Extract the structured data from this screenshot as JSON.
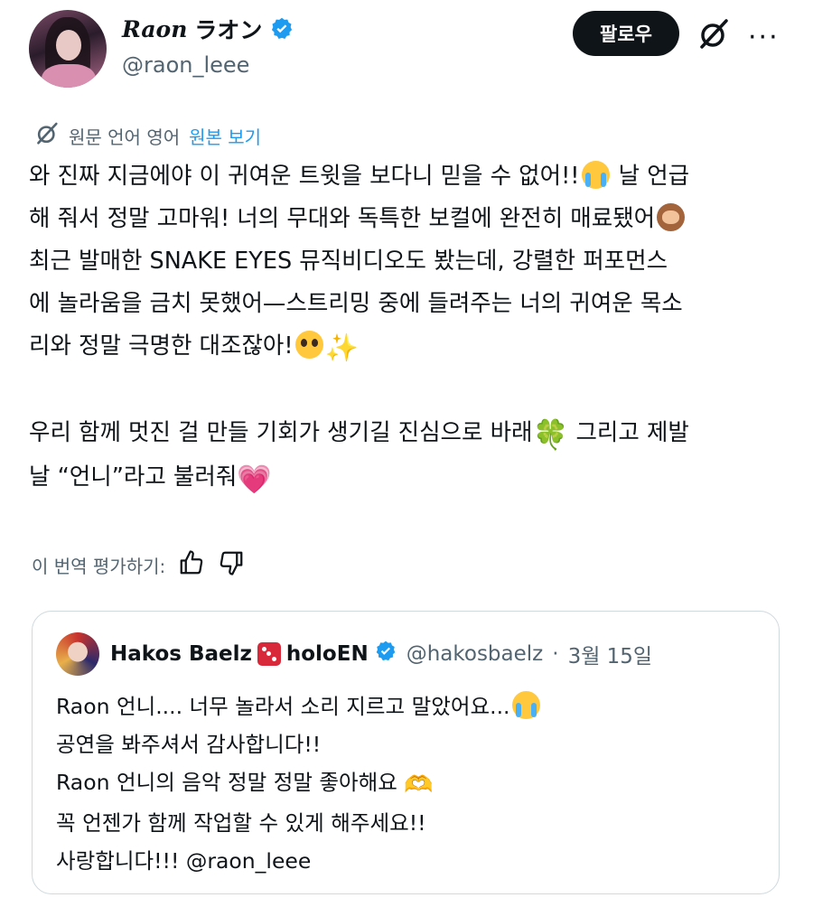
{
  "author": {
    "name_latin": "Raon",
    "name_korean": "ラオン",
    "handle": "@raon_leee"
  },
  "header": {
    "follow_label": "팔로우",
    "more_label": "···"
  },
  "translation": {
    "meta": "원문 언어 영어",
    "show_original": "원본 보기"
  },
  "tweet": {
    "lines": [
      "와 진짜 지금에야 이 귀여운 트윗을 보다니 믿을 수 없어!!",
      " 날 언급",
      "해 줘서 정말 고마워! 너의 무대와 독특한 보컬에 완전히 매료됐어",
      "최근 발매한 SNAKE EYES 뮤직비디오도 봤는데, 강렬한 퍼포먼스",
      "에 놀라움을 금치 못했어—스트리밍 중에 들려주는 너의 귀여운 목소",
      "리와 정말 극명한 대조잖아!",
      "우리 함께 멋진 걸 만들 기회가 생기길 진심으로 바래",
      " 그리고 제발",
      "날 “언니”라고 불러줘"
    ],
    "emoji": {
      "sparkle": "✨",
      "clover": "🍀",
      "heart": "💗"
    }
  },
  "rating": {
    "label": "이 번역 평가하기:"
  },
  "quote": {
    "name": "Hakos Baelz",
    "name_suffix": "holoEN",
    "handle": "@hakosbaelz",
    "date": "3월 15일",
    "separator": "·",
    "lines": [
      "Raon 언니.... 너무 놀라서 소리 지르고 말았어요...",
      "공연을 봐주셔서 감사합니다!!",
      "Raon 언니의 음악 정말 정말 좋아해요",
      "꼭 언젠가 함께 작업할 수 있게 해주세요!!",
      "사랑합니다!!! @raon_leee"
    ],
    "hands_emoji": "🫶"
  },
  "colors": {
    "accent": "#1d9bf0",
    "text": "#0f1419",
    "secondary": "#536471",
    "border": "#cfd9de"
  }
}
